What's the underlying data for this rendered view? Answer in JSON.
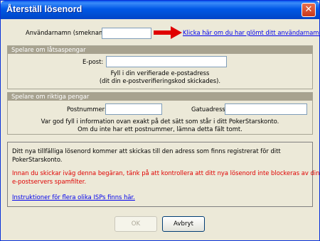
{
  "window": {
    "title": "Återställ lösenord",
    "close_label": "✕"
  },
  "username": {
    "label": "Användarnamn (smeknamn):",
    "value": "",
    "forgot_link": "Klicka här om du har glömt ditt användarnamn"
  },
  "play_money": {
    "header": "Spelare om låtsaspengar",
    "email_label": "E-post:",
    "email_value": "",
    "hint1": "Fyll i din verifierade e-postadress",
    "hint2": "(dit din e-postverifieringskod skickades)."
  },
  "real_money": {
    "header": "Spelare om riktiga pengar",
    "postal_label": "Postnummer:",
    "postal_value": "",
    "street_label": "Gatuadress:",
    "street_value": "",
    "hint1": "Var god fyll i information ovan exakt på det sätt som står i ditt PokerStarskonto.",
    "hint2": "Om du inte har ett postnummer, lämna detta fält tomt."
  },
  "info": {
    "line1": "Ditt nya tillfälliga lösenord kommer att skickas till den adress som finns registrerat för ditt",
    "line2": "PokerStarskonto.",
    "warn1": "Innan du skickar iväg denna begäran, tänk på att kontrollera att ditt nya lösenord inte blockeras av din",
    "warn2": "e-postservers spamfilter.",
    "isp_link": "Instruktioner för flera olika ISPs finns här."
  },
  "buttons": {
    "ok": "OK",
    "cancel": "Avbryt"
  },
  "colors": {
    "arrow": "#E00000",
    "title_bar": "#0054E3",
    "group_header": "#A7A28F"
  }
}
